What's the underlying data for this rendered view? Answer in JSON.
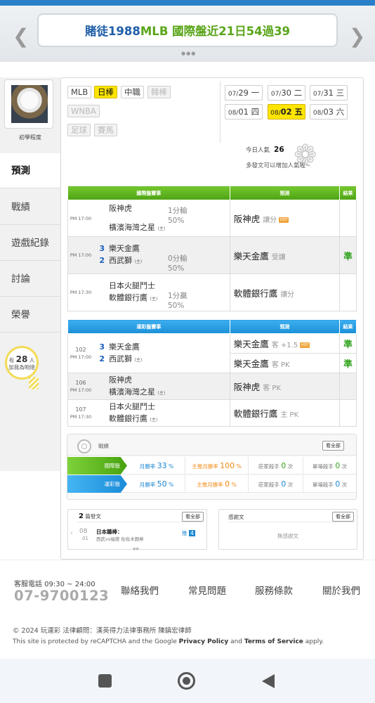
{
  "banner": {
    "title_part1": "賭徒1988 ",
    "title_part2": "MLB 國際盤近21日54過39"
  },
  "profile": {
    "level": "初學程度"
  },
  "sidebar": {
    "items": [
      "預測",
      "戰績",
      "遊戲紀錄",
      "討論",
      "榮譽"
    ]
  },
  "helpers": {
    "prefix": "有",
    "count": "28",
    "unit": "人",
    "line2": "加我為明燈"
  },
  "leagues": [
    "MLB",
    "日棒",
    "中職",
    "韓棒",
    "WNBA",
    "足球",
    "賽馬"
  ],
  "dates": [
    {
      "md": "07/",
      "d": "29",
      "w": "一"
    },
    {
      "md": "07/",
      "d": "30",
      "w": "二"
    },
    {
      "md": "07/",
      "d": "31",
      "w": "三"
    },
    {
      "md": "08/",
      "d": "01",
      "w": "四"
    },
    {
      "md": "08/",
      "d": "02",
      "w": "五"
    },
    {
      "md": "08/",
      "d": "03",
      "w": "六"
    }
  ],
  "popularity": {
    "label": "今日人氣",
    "value": "26",
    "hint": "多發文可以增加人氣喔~"
  },
  "intl": {
    "headers": {
      "match": "國際盤賽事",
      "pred": "預測",
      "result": "結果"
    },
    "rows": [
      {
        "time": "PM 17:00",
        "n1": "",
        "team1": "阪神虎",
        "n2": "",
        "team2": "橫濱海灣之星",
        "t2mark": "(主)",
        "hc1": "1分輸",
        "hc2": "50%",
        "pick": "阪神虎",
        "pick_sub": "讓分",
        "hot": true,
        "result": ""
      },
      {
        "time": "PM 17:00",
        "n1": "3",
        "team1": "樂天金鷹",
        "n2": "2",
        "team2": "西武獅",
        "t2mark": "(主)",
        "hc1": "0分輸",
        "hc2": "50%",
        "pick": "樂天金鷹",
        "pick_sub": "受讓",
        "hot": false,
        "result": "準"
      },
      {
        "time": "PM 17:30",
        "n1": "",
        "team1": "日本火腿鬥士",
        "n2": "",
        "team2": "軟體銀行鷹",
        "t2mark": "(主)",
        "hc1": "1分贏",
        "hc2": "50%",
        "pick": "軟體銀行鷹",
        "pick_sub": "讓分",
        "hot": false,
        "result": ""
      }
    ]
  },
  "lottery": {
    "headers": {
      "match": "運彩盤賽事",
      "pred": "預測",
      "result": "結果"
    },
    "rows": [
      {
        "no": "102",
        "time": "PM 17:00",
        "n1": "3",
        "team1": "樂天金鷹",
        "n2": "2",
        "team2": "西武獅",
        "t2mark": "(主)",
        "picks": [
          {
            "pick": "樂天金鷹",
            "sub": "客 +1.5",
            "hot": true,
            "result": "準"
          },
          {
            "pick": "樂天金鷹",
            "sub": "客 PK",
            "hot": false,
            "result": "準"
          }
        ]
      },
      {
        "no": "106",
        "time": "PM 17:00",
        "n1": "",
        "team1": "阪神虎",
        "n2": "",
        "team2": "橫濱海灣之星",
        "t2mark": "(主)",
        "picks": [
          {
            "pick": "阪神虎",
            "sub": "客 PK",
            "hot": false,
            "result": ""
          }
        ]
      },
      {
        "no": "107",
        "time": "PM 17:30",
        "n1": "",
        "team1": "日本火腿鬥士",
        "n2": "",
        "team2": "軟體銀行鷹",
        "t2mark": "(主)",
        "picks": [
          {
            "pick": "軟體銀行鷹",
            "sub": "主 PK",
            "hot": false,
            "result": ""
          }
        ]
      }
    ]
  },
  "stats": {
    "title": "戰績",
    "more": "看全部",
    "rows": [
      {
        "label": "國際盤",
        "month_label": "月勝率",
        "month": "33",
        "main_label": "主推月勝率",
        "main": "100",
        "pct": "%",
        "banker_label": "莊家殺手",
        "banker": "0",
        "single_label": "單場殺手",
        "single": "0",
        "unit": "次"
      },
      {
        "label": "運彩盤",
        "month_label": "月勝率",
        "month": "50",
        "main_label": "主推月勝率",
        "main": "0",
        "pct": "%",
        "banker_label": "莊家殺手",
        "banker": "0",
        "single_label": "單場殺手",
        "single": "0",
        "unit": "次"
      }
    ]
  },
  "posts": {
    "count": "2",
    "label": "篇發文",
    "more": "看全部",
    "item": {
      "month": "08",
      "day": "01",
      "title": "日本職棒：",
      "sub": "西武vs福德 佐佐木朗希",
      "tag": "推",
      "num": "4"
    }
  },
  "reviews": {
    "label": "感謝文",
    "more": "看全部",
    "empty": "無感謝文"
  },
  "footer": {
    "service": "客服電話 09:30 ~ 24:00",
    "phone": "07-9700123",
    "links": [
      "聯絡我們",
      "常見問題",
      "服務條款",
      "關於我們"
    ],
    "copyright": "© 2024 玩運彩 法律顧問：漢英得力法律事務所 陳鎮宏律師",
    "captcha_1": "This site is protected by reCAPTCHA and the Google ",
    "captcha_pp": "Privacy Policy",
    "captcha_and": " and ",
    "captcha_tos": "Terms of Service",
    "captcha_end": " apply."
  },
  "hot_label": "HOT",
  "colors": {
    "intl_green": "#4ea314",
    "lottery_blue": "#1a90d8",
    "selected_yellow": "#ffe500",
    "win_green": "#2fa21c"
  }
}
